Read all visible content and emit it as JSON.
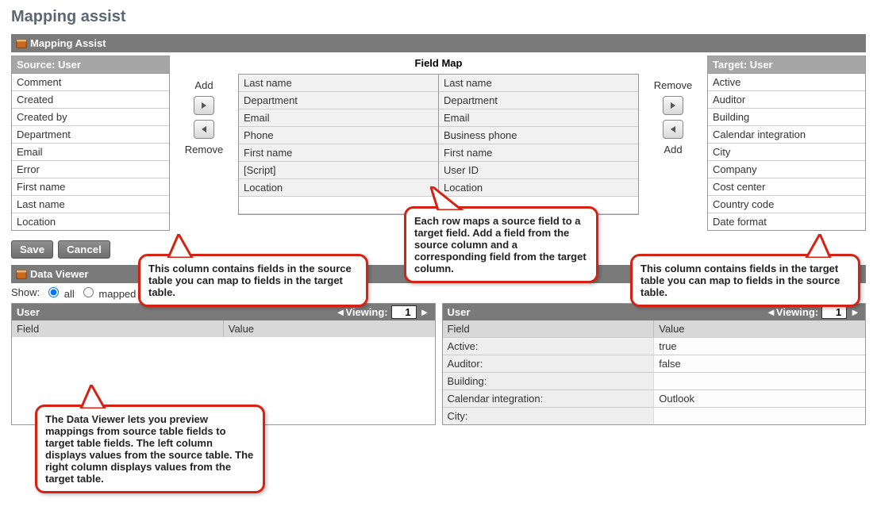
{
  "pageTitle": "Mapping assist",
  "mappingHeader": "Mapping Assist",
  "sourceHeader": "Source: User",
  "targetHeader": "Target: User",
  "fieldMapTitle": "Field Map",
  "addLabel": "Add",
  "removeLabel": "Remove",
  "saveLabel": "Save",
  "cancelLabel": "Cancel",
  "dataViewerHeader": "Data Viewer",
  "showLabel": "Show:",
  "showAll": "all",
  "showMapped": "mapped",
  "sourceFields": [
    "Comment",
    "Created",
    "Created by",
    "Department",
    "Email",
    "Error",
    "First name",
    "Last name",
    "Location"
  ],
  "targetFields": [
    "Active",
    "Auditor",
    "Building",
    "Calendar integration",
    "City",
    "Company",
    "Cost center",
    "Country code",
    "Date format"
  ],
  "fieldMapLeft": [
    "Last name",
    "Department",
    "Email",
    "Phone",
    "First name",
    "[Script]",
    "Location",
    ""
  ],
  "fieldMapRight": [
    "Last name",
    "Department",
    "Email",
    "Business phone",
    "First name",
    "User ID",
    "Location",
    ""
  ],
  "viewer": {
    "left": {
      "title": "User",
      "viewingLabel": "◄Viewing:",
      "page": "1",
      "cols": [
        "Field",
        "Value"
      ],
      "rows": []
    },
    "right": {
      "title": "User",
      "viewingLabel": "◄Viewing:",
      "page": "1",
      "cols": [
        "Field",
        "Value"
      ],
      "rows": [
        {
          "f": "Active:",
          "v": "true"
        },
        {
          "f": "Auditor:",
          "v": "false"
        },
        {
          "f": "Building:",
          "v": ""
        },
        {
          "f": "Calendar integration:",
          "v": "Outlook"
        },
        {
          "f": "City:",
          "v": ""
        }
      ]
    }
  },
  "callouts": {
    "source": "This column contains fields in the source table you can map to fields in the target table.",
    "map": "Each row maps a source field to a target field. Add a field from the source column and a corresponding field from the target column.",
    "target": "This column contains fields in the target table you can map to fields in the source table.",
    "viewer": "The Data Viewer lets you preview mappings from source table fields to target table fields. The left column displays values from the source table. The right column displays values from the target table."
  }
}
